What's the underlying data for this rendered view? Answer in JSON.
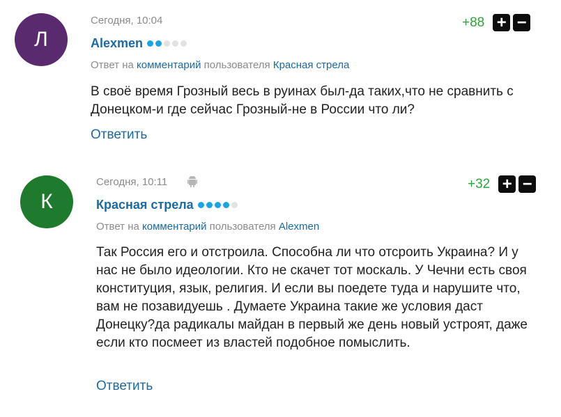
{
  "comments": [
    {
      "avatar_letter": "Л",
      "avatar_color": "#5a2a6e",
      "time": "Сегодня, 10:04",
      "author": "Alexmen",
      "rating_on": 2,
      "rating_total": 5,
      "score": "+88",
      "reply_prefix": "Ответ на",
      "reply_link": "комментарий",
      "reply_mid": "пользователя",
      "reply_user": "Красная стрела",
      "text": "В своё время Грозный весь в руинах был-да таких,что не сравнить с Донецком-и где сейчас Грозный-не в России что ли?",
      "answer": "Ответить",
      "device_icon": ""
    },
    {
      "avatar_letter": "К",
      "avatar_color": "#1e7a2c",
      "time": "Сегодня, 10:11",
      "author": "Красная стрела",
      "rating_on": 4,
      "rating_total": 5,
      "score": "+32",
      "reply_prefix": "Ответ на",
      "reply_link": "комментарий",
      "reply_mid": "пользователя",
      "reply_user": "Alexmen",
      "text": "Так Россия его и отстроила. Способна ли что отсроить Украина? И у нас не было идеологии. Кто не скачет тот москаль. У Чечни есть своя конституция, язык, религия. И если вы поедете туда и нарушите что, вам не позавидуешь . Думаете Украина такие же условия даст Донецку?да радикалы майдан в первый же день новый устроят, даже если кто посмеет из властей подобное помыслить.",
      "answer": "Ответить",
      "device_icon": "android-icon"
    }
  ],
  "vote_plus": "+",
  "vote_minus": "−",
  "colors": {
    "link": "#1a6aa6",
    "score": "#2fa33a",
    "meta": "#8a8a8a",
    "rating_on": "#1aa3e8",
    "rating_off": "#e2e2e2"
  }
}
